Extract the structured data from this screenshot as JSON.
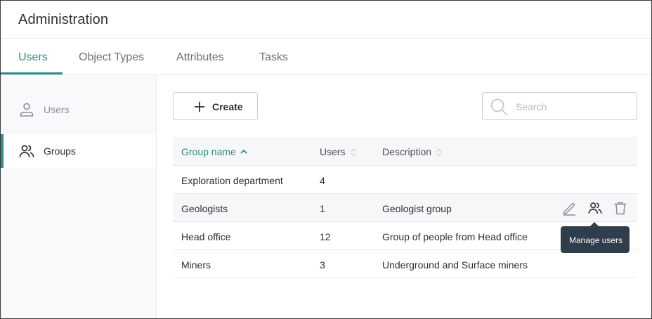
{
  "header": {
    "title": "Administration"
  },
  "tabs": [
    {
      "label": "Users",
      "active": true
    },
    {
      "label": "Object Types",
      "active": false
    },
    {
      "label": "Attributes",
      "active": false
    },
    {
      "label": "Tasks",
      "active": false
    }
  ],
  "sidebar": {
    "items": [
      {
        "label": "Users",
        "icon": "user-icon",
        "active": false
      },
      {
        "label": "Groups",
        "icon": "users-group-icon",
        "active": true
      }
    ]
  },
  "toolbar": {
    "create_label": "Create"
  },
  "search": {
    "placeholder": "Search",
    "value": ""
  },
  "table": {
    "columns": [
      {
        "label": "Group name",
        "sort": "ascending"
      },
      {
        "label": "Users",
        "sort": "none"
      },
      {
        "label": "Description",
        "sort": "none"
      }
    ],
    "rows": [
      {
        "name": "Exploration department",
        "users": "4",
        "description": ""
      },
      {
        "name": "Geologists",
        "users": "1",
        "description": "Geologist group"
      },
      {
        "name": "Head office",
        "users": "12",
        "description": "Group of people from Head office"
      },
      {
        "name": "Miners",
        "users": "3",
        "description": "Underground and Surface miners"
      }
    ],
    "hovered_row": 1,
    "row_actions": [
      "edit-icon",
      "manage-users-icon",
      "delete-icon"
    ]
  },
  "tooltip": {
    "text": "Manage users"
  },
  "colors": {
    "accent": "#2a8f86",
    "tooltip_bg": "#2f3d4c"
  }
}
